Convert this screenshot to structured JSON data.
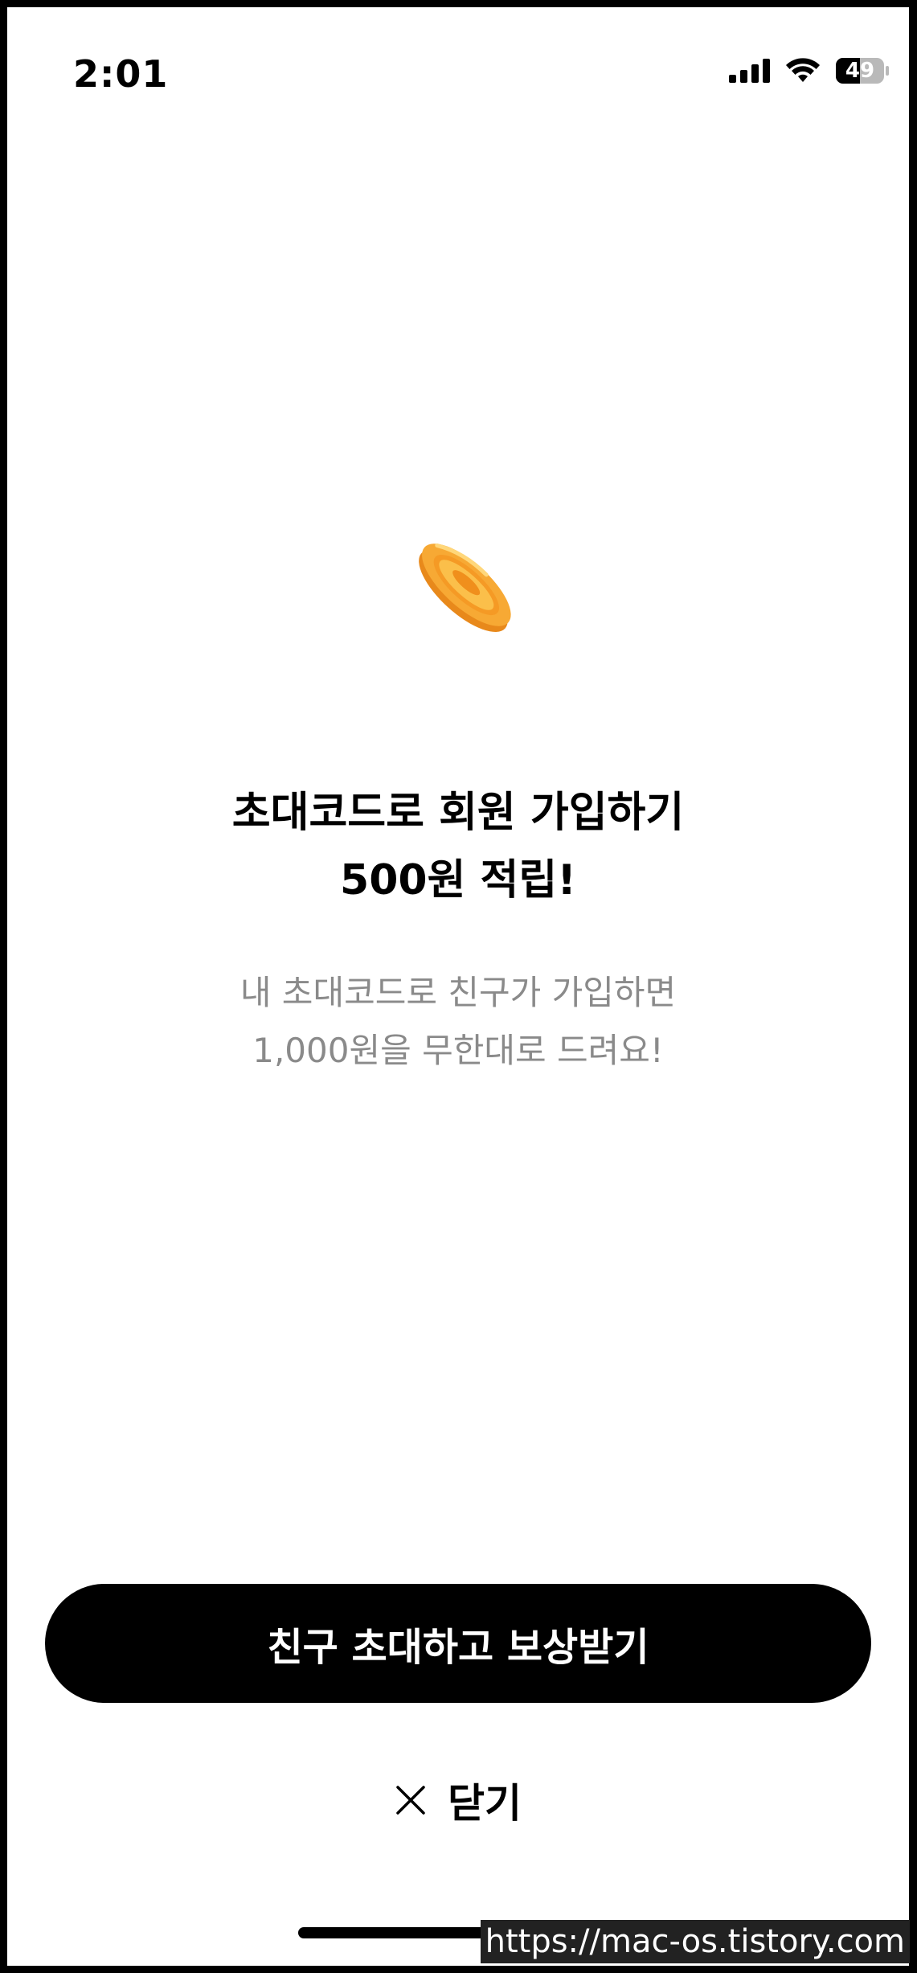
{
  "status_bar": {
    "time": "2:01",
    "battery_level": "49",
    "icons": [
      "signal-icon",
      "wifi-icon",
      "battery-icon"
    ]
  },
  "hero": {
    "icon": "coin-icon",
    "coin_color": "#F5A623"
  },
  "headline": {
    "line1": "초대코드로 회원 가입하기",
    "line2": "500원 적립!"
  },
  "description": {
    "line1": "내 초대코드로 친구가 가입하면",
    "line2": "1,000원을 무한대로 드려요!"
  },
  "actions": {
    "invite_button_label": "친구 초대하고 보상받기",
    "close_label": "닫기"
  },
  "watermark": "https://mac-os.tistory.com"
}
